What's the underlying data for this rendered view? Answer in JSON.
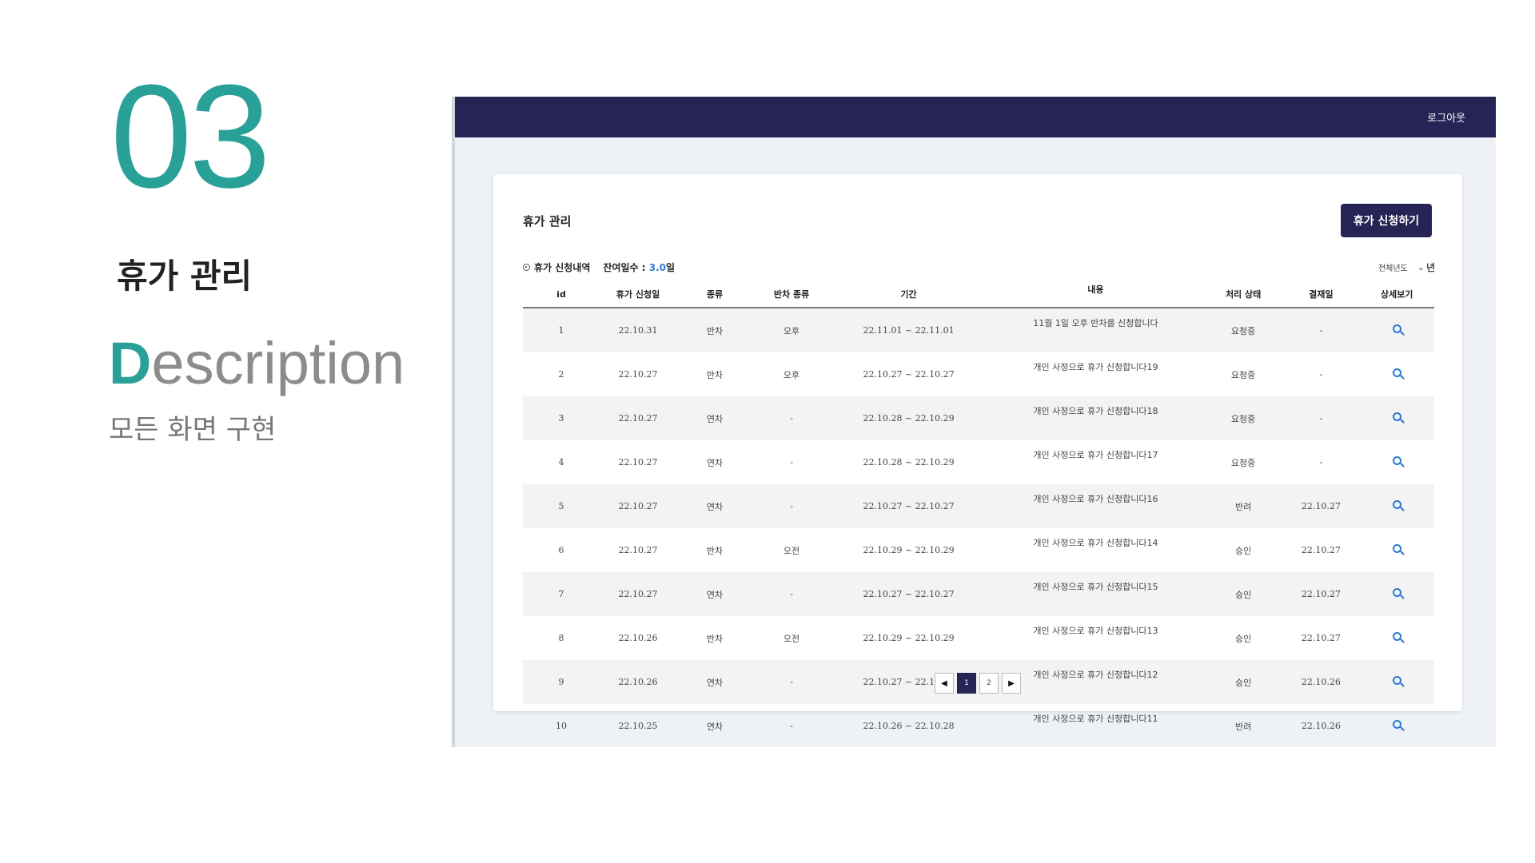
{
  "slide": {
    "number": "03",
    "title": "휴가 관리",
    "desc_cap": "D",
    "desc_rest": "escription",
    "desc_sub": "모든 화면 구현"
  },
  "app": {
    "logout": "로그아웃",
    "page_title": "휴가 관리",
    "apply_button": "휴가 신청하기",
    "history_label": "휴가 신청내역",
    "remaining_label": "잔여일수 : ",
    "remaining_value": "3.0",
    "remaining_unit": "일",
    "year_filter_label": "전체년도",
    "year_unit": "년",
    "columns": [
      "id",
      "휴가 신청일",
      "종류",
      "반차 종류",
      "기간",
      "내용",
      "처리 상태",
      "결재일",
      "상세보기"
    ],
    "rows": [
      {
        "id": "1",
        "date": "22.10.31",
        "type": "반차",
        "half": "오후",
        "period": "22.11.01 ~ 22.11.01",
        "content": "11월 1일 오후 반차를 신청합니다",
        "status": "요청중",
        "approved": "-"
      },
      {
        "id": "2",
        "date": "22.10.27",
        "type": "반차",
        "half": "오후",
        "period": "22.10.27 ~ 22.10.27",
        "content": "개인 사정으로 휴가 신청합니다19",
        "status": "요청중",
        "approved": "-"
      },
      {
        "id": "3",
        "date": "22.10.27",
        "type": "연차",
        "half": "-",
        "period": "22.10.28 ~ 22.10.29",
        "content": "개인 사정으로 휴가 신청합니다18",
        "status": "요청중",
        "approved": "-"
      },
      {
        "id": "4",
        "date": "22.10.27",
        "type": "연차",
        "half": "-",
        "period": "22.10.28 ~ 22.10.29",
        "content": "개인 사정으로 휴가 신청합니다17",
        "status": "요청중",
        "approved": "-"
      },
      {
        "id": "5",
        "date": "22.10.27",
        "type": "연차",
        "half": "-",
        "period": "22.10.27 ~ 22.10.27",
        "content": "개인 사정으로 휴가 신청합니다16",
        "status": "반려",
        "approved": "22.10.27"
      },
      {
        "id": "6",
        "date": "22.10.27",
        "type": "반차",
        "half": "오전",
        "period": "22.10.29 ~ 22.10.29",
        "content": "개인 사정으로 휴가 신청합니다14",
        "status": "승인",
        "approved": "22.10.27"
      },
      {
        "id": "7",
        "date": "22.10.27",
        "type": "연차",
        "half": "-",
        "period": "22.10.27 ~ 22.10.27",
        "content": "개인 사정으로 휴가 신청합니다15",
        "status": "승인",
        "approved": "22.10.27"
      },
      {
        "id": "8",
        "date": "22.10.26",
        "type": "반차",
        "half": "오전",
        "period": "22.10.29 ~ 22.10.29",
        "content": "개인 사정으로 휴가 신청합니다13",
        "status": "승인",
        "approved": "22.10.27"
      },
      {
        "id": "9",
        "date": "22.10.26",
        "type": "연차",
        "half": "-",
        "period": "22.10.27 ~ 22.10.29",
        "content": "개인 사정으로 휴가 신청합니다12",
        "status": "승인",
        "approved": "22.10.26"
      },
      {
        "id": "10",
        "date": "22.10.25",
        "type": "연차",
        "half": "-",
        "period": "22.10.26 ~ 22.10.28",
        "content": "개인 사정으로 휴가 신청합니다11",
        "status": "반려",
        "approved": "22.10.26"
      }
    ],
    "pagination": {
      "prev": "◀",
      "pages": [
        "1",
        "2"
      ],
      "next": "▶",
      "active": "1"
    },
    "colors": {
      "accent": "#2aa198",
      "navy": "#262455",
      "link_blue": "#2a78d6"
    }
  }
}
